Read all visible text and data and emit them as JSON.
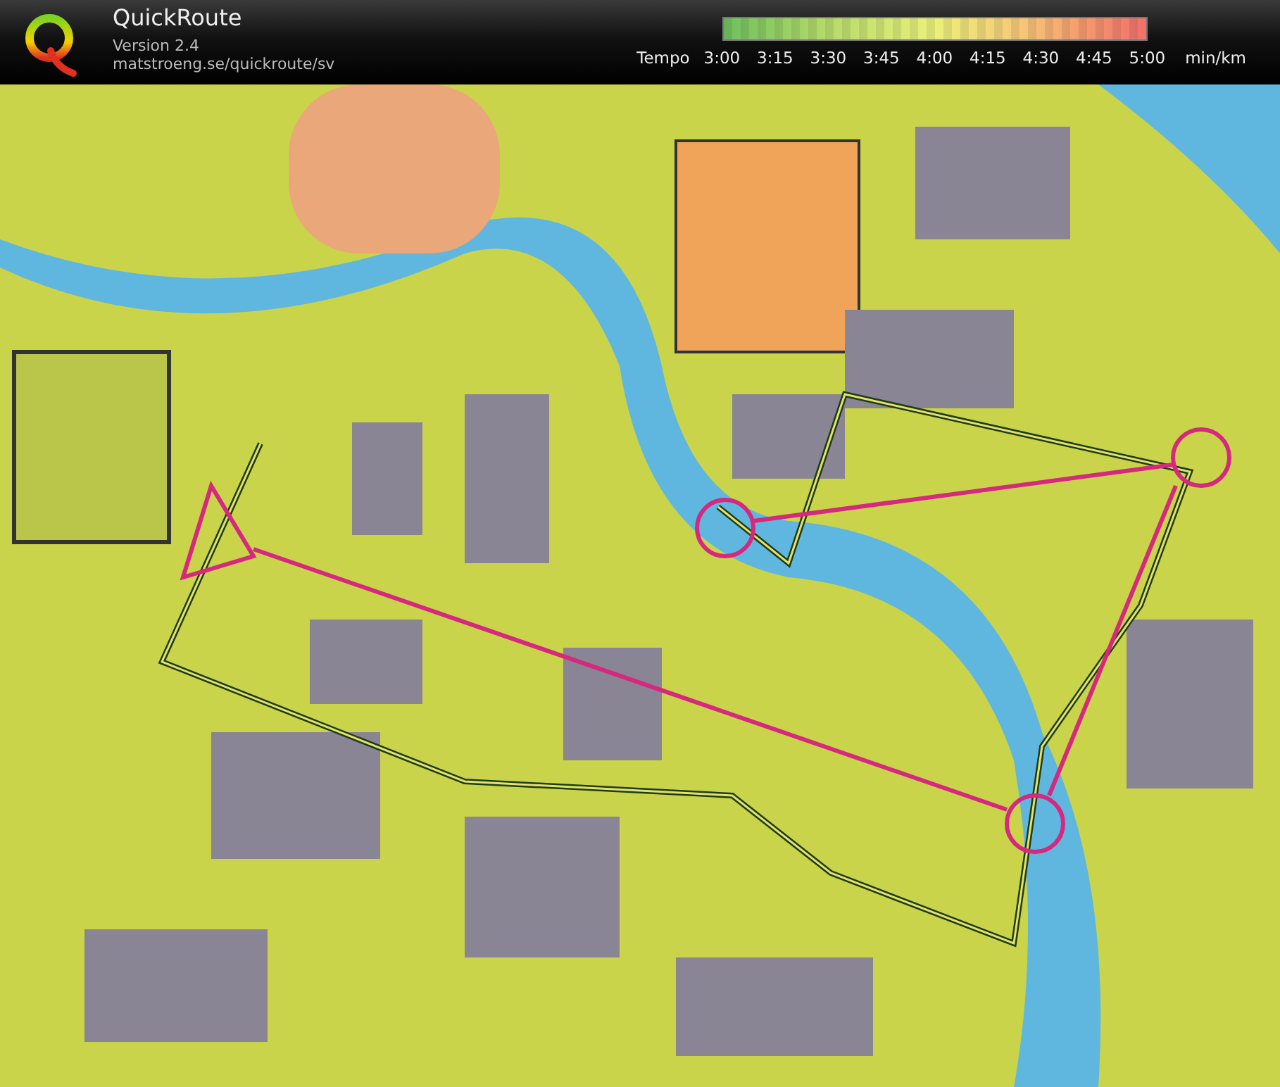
{
  "app": {
    "title": "QuickRoute",
    "version": "Version 2.4",
    "url": "matstroeng.se/quickroute/sv"
  },
  "tempo_scale": {
    "label": "Tempo",
    "ticks": [
      "3:00",
      "3:15",
      "3:30",
      "3:45",
      "4:00",
      "4:15",
      "4:30",
      "4:45",
      "5:00"
    ],
    "unit": "min/km"
  }
}
